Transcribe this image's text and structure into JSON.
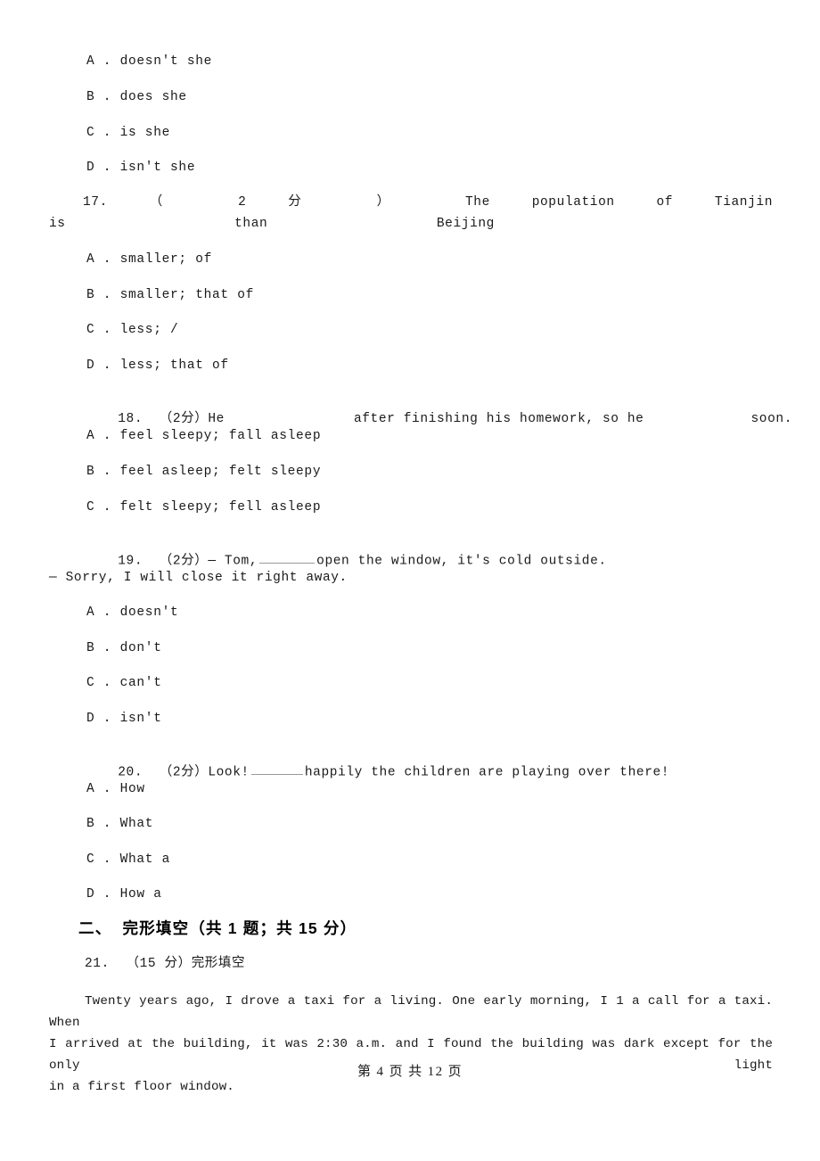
{
  "document": {
    "type": "exam-paper",
    "footer": "第 4 页 共 12 页"
  },
  "questions": [
    {
      "id": "q16-options",
      "options": [
        "A . doesn't she",
        "B . does she",
        "C . is she",
        "D . isn't she"
      ]
    },
    {
      "id": "q17",
      "number": "17.",
      "score": "（2 分）",
      "stem_line1_parts": [
        "17.",
        "（",
        "2",
        "分",
        "）",
        "The",
        "population",
        "of",
        "Tianjin"
      ],
      "stem_line2_parts": [
        "is",
        "than",
        "Beijing"
      ],
      "options": [
        "A . smaller; of",
        "B . smaller; that of",
        "C . less; /",
        "D . less; that of"
      ]
    },
    {
      "id": "q18",
      "number": "18.",
      "score": "（2分）",
      "stem_prefix": "18.  （2分）He",
      "stem_middle": "after finishing his homework, so he",
      "stem_suffix": "soon.",
      "options": [
        "A . feel sleepy; fall asleep",
        "B . feel asleep; felt sleepy",
        "C . felt sleepy; fell asleep"
      ]
    },
    {
      "id": "q19",
      "number": "19.",
      "score": "（2分）",
      "stem_before_blank": "19.  （2分）— Tom,",
      "stem_after_blank": "open the window, it's cold outside.",
      "stem_line2": "— Sorry, I will close it right away.",
      "options": [
        "A . doesn't",
        "B . don't",
        "C . can't",
        "D . isn't"
      ]
    },
    {
      "id": "q20",
      "number": "20.",
      "score": "（2分）",
      "stem_before_blank": "20.  （2分）Look!",
      "stem_after_blank": "happily the children are playing over there!",
      "options": [
        "A . How",
        "B . What",
        "C . What a",
        "D . How a"
      ]
    }
  ],
  "section": {
    "heading": "二、  完形填空（共 1 题；共 15 分）",
    "question": {
      "id": "q21",
      "label": "21.  （15 分）完形填空",
      "passage_line1": "Twenty years ago, I drove a taxi for a living. One early morning, I 1  a call for a taxi. When",
      "passage_line2": "I arrived at the building, it was 2:30 a.m. and I found the building was dark except for the only light",
      "passage_line3": "in a first floor window."
    }
  }
}
